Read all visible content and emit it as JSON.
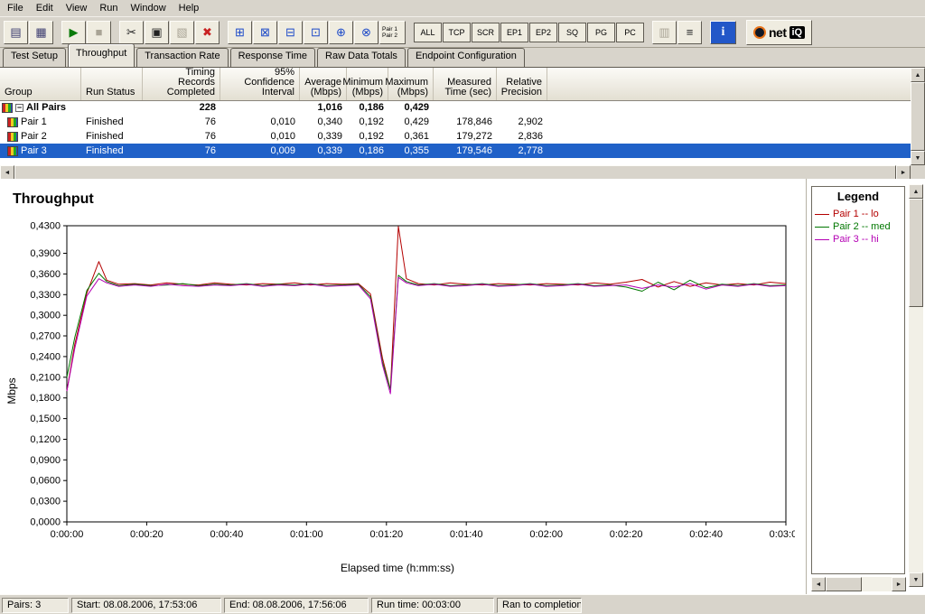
{
  "icons": {
    "arrow_up": "▲",
    "arrow_down": "▼",
    "arrow_left": "◄",
    "arrow_right": "►"
  },
  "colors": {
    "selected_row_bg": "#2061c8",
    "series_pair1": "#b40000",
    "series_pair2": "#007700",
    "series_pair3": "#b400b4"
  },
  "menu": {
    "items": [
      "File",
      "Edit",
      "View",
      "Run",
      "Window",
      "Help"
    ]
  },
  "toolbar": {
    "buttons": [
      {
        "name": "save-button",
        "glyph": "▤",
        "color": "#3a3a6e"
      },
      {
        "name": "print-button",
        "glyph": "▦",
        "color": "#3a3a6e"
      },
      {
        "type": "sep"
      },
      {
        "name": "run-test-button",
        "glyph": "▶",
        "color": "#0a7a0a"
      },
      {
        "name": "abort-run-button",
        "glyph": "■",
        "color": "#a9a496",
        "disabled": true
      },
      {
        "type": "sep"
      },
      {
        "name": "cut-button",
        "glyph": "✂",
        "color": "#222222"
      },
      {
        "name": "copy-button",
        "glyph": "▣",
        "color": "#222222"
      },
      {
        "name": "paste-button",
        "glyph": "▧",
        "color": "#a9a496",
        "disabled": true
      },
      {
        "name": "delete-button",
        "glyph": "✖",
        "color": "#c82222"
      },
      {
        "type": "sep"
      },
      {
        "name": "add-pair-button",
        "glyph": "⊞",
        "color": "#1b49c8"
      },
      {
        "name": "add-multicast-group-button",
        "glyph": "⊠",
        "color": "#1b49c8"
      },
      {
        "name": "edit-pair-button",
        "glyph": "⊟",
        "color": "#1b49c8"
      },
      {
        "name": "replicate-pair-button",
        "glyph": "⊡",
        "color": "#1b49c8"
      },
      {
        "name": "swap-endpoints-button",
        "glyph": "⊕",
        "color": "#1b49c8"
      },
      {
        "name": "group-pairs-button",
        "glyph": "⊗",
        "color": "#1b49c8"
      },
      {
        "name": "pair-list-button",
        "type": "pairtext",
        "lines": [
          "Pair 1",
          "Pair 2"
        ]
      },
      {
        "type": "sep"
      },
      {
        "name": "filter-all-button",
        "type": "text",
        "label": "ALL"
      },
      {
        "name": "filter-tcp-button",
        "type": "text",
        "label": "TCP"
      },
      {
        "name": "filter-scr-button",
        "type": "text",
        "label": "SCR"
      },
      {
        "name": "filter-ep1-button",
        "type": "text",
        "label": "EP1"
      },
      {
        "name": "filter-ep2-button",
        "type": "text",
        "label": "EP2"
      },
      {
        "name": "filter-sq-button",
        "type": "text",
        "label": "SQ"
      },
      {
        "name": "filter-pg-button",
        "type": "text",
        "label": "PG"
      },
      {
        "name": "filter-pc-button",
        "type": "text",
        "label": "PC"
      },
      {
        "type": "sep"
      },
      {
        "name": "column-options-button",
        "glyph": "▥",
        "color": "#a9a496",
        "disabled": true
      },
      {
        "name": "show-grid-button",
        "glyph": "≡",
        "color": "#222222"
      },
      {
        "type": "sep"
      },
      {
        "name": "help-info-button",
        "type": "info",
        "label": "i"
      },
      {
        "type": "sep"
      },
      {
        "name": "netiq-logo",
        "type": "logo",
        "text_net": "net",
        "text_iq": "iQ"
      }
    ]
  },
  "tabs": {
    "active_index": 1,
    "items": [
      "Test Setup",
      "Throughput",
      "Transaction Rate",
      "Response Time",
      "Raw Data Totals",
      "Endpoint Configuration"
    ]
  },
  "table": {
    "columns": [
      {
        "key": "group",
        "label": "Group",
        "width": 90,
        "align": "left"
      },
      {
        "key": "status",
        "label": "Run Status",
        "width": 68,
        "align": "left"
      },
      {
        "key": "records",
        "label": "Timing Records\nCompleted",
        "width": 86,
        "align": "right"
      },
      {
        "key": "confidence",
        "label": "95% Confidence\nInterval",
        "width": 88,
        "align": "right"
      },
      {
        "key": "avg",
        "label": "Average\n(Mbps)",
        "width": 52,
        "align": "right"
      },
      {
        "key": "min",
        "label": "Minimum\n(Mbps)",
        "width": 46,
        "align": "right"
      },
      {
        "key": "max",
        "label": "Maximum\n(Mbps)",
        "width": 50,
        "align": "right"
      },
      {
        "key": "time",
        "label": "Measured\nTime (sec)",
        "width": 70,
        "align": "right"
      },
      {
        "key": "precision",
        "label": "Relative\nPrecision",
        "width": 56,
        "align": "right"
      }
    ],
    "rows": [
      {
        "group": "All Pairs",
        "expand": "−",
        "bold": true,
        "status": "",
        "records": "228",
        "confidence": "",
        "avg": "1,016",
        "min": "0,186",
        "max": "0,429",
        "time": "",
        "precision": ""
      },
      {
        "group": "Pair 1",
        "indent": true,
        "status": "Finished",
        "records": "76",
        "confidence": "0,010",
        "avg": "0,340",
        "min": "0,192",
        "max": "0,429",
        "time": "178,846",
        "precision": "2,902"
      },
      {
        "group": "Pair 2",
        "indent": true,
        "status": "Finished",
        "records": "76",
        "confidence": "0,010",
        "avg": "0,339",
        "min": "0,192",
        "max": "0,361",
        "time": "179,272",
        "precision": "2,836"
      },
      {
        "group": "Pair 3",
        "indent": true,
        "selected": true,
        "status": "Finished",
        "records": "76",
        "confidence": "0,009",
        "avg": "0,339",
        "min": "0,186",
        "max": "0,355",
        "time": "179,546",
        "precision": "2,778"
      }
    ]
  },
  "chart_data": {
    "type": "line",
    "title": "Throughput",
    "xlabel": "Elapsed time (h:mm:ss)",
    "ylabel": "Mbps",
    "xlim": [
      0,
      180
    ],
    "ylim": [
      0,
      0.43
    ],
    "grid": false,
    "legend_position": "right-panel",
    "x_unit": "seconds",
    "xtick_values": [
      0,
      20,
      40,
      60,
      80,
      100,
      120,
      140,
      160,
      180
    ],
    "xtick_labels": [
      "0:00:00",
      "0:00:20",
      "0:00:40",
      "0:01:00",
      "0:01:20",
      "0:01:40",
      "0:02:00",
      "0:02:20",
      "0:02:40",
      "0:03:00"
    ],
    "ytick_values": [
      0,
      0.03,
      0.06,
      0.09,
      0.12,
      0.15,
      0.18,
      0.21,
      0.24,
      0.27,
      0.3,
      0.33,
      0.36,
      0.39,
      0.43
    ],
    "ytick_labels": [
      "0,0000",
      "0,0300",
      "0,0600",
      "0,0900",
      "0,1200",
      "0,1500",
      "0,1800",
      "0,2100",
      "0,2400",
      "0,2700",
      "0,3000",
      "0,3300",
      "0,3600",
      "0,3900",
      "0,4300"
    ],
    "series": [
      {
        "name": "Pair 1 -- lo",
        "color": "#b40000",
        "points": [
          [
            0,
            0.19
          ],
          [
            2,
            0.258
          ],
          [
            5,
            0.332
          ],
          [
            8,
            0.378
          ],
          [
            10,
            0.351
          ],
          [
            13,
            0.345
          ],
          [
            17,
            0.346
          ],
          [
            21,
            0.344
          ],
          [
            25,
            0.347
          ],
          [
            29,
            0.345
          ],
          [
            33,
            0.344
          ],
          [
            37,
            0.347
          ],
          [
            41,
            0.345
          ],
          [
            45,
            0.344
          ],
          [
            49,
            0.346
          ],
          [
            53,
            0.345
          ],
          [
            57,
            0.347
          ],
          [
            61,
            0.344
          ],
          [
            65,
            0.346
          ],
          [
            69,
            0.345
          ],
          [
            73,
            0.346
          ],
          [
            76,
            0.331
          ],
          [
            79,
            0.238
          ],
          [
            81,
            0.192
          ],
          [
            83,
            0.429
          ],
          [
            85,
            0.353
          ],
          [
            88,
            0.346
          ],
          [
            92,
            0.344
          ],
          [
            96,
            0.347
          ],
          [
            100,
            0.345
          ],
          [
            104,
            0.344
          ],
          [
            108,
            0.346
          ],
          [
            112,
            0.345
          ],
          [
            116,
            0.344
          ],
          [
            120,
            0.346
          ],
          [
            124,
            0.345
          ],
          [
            128,
            0.344
          ],
          [
            132,
            0.347
          ],
          [
            136,
            0.345
          ],
          [
            140,
            0.348
          ],
          [
            144,
            0.352
          ],
          [
            148,
            0.341
          ],
          [
            152,
            0.349
          ],
          [
            156,
            0.342
          ],
          [
            160,
            0.347
          ],
          [
            164,
            0.344
          ],
          [
            168,
            0.346
          ],
          [
            172,
            0.344
          ],
          [
            176,
            0.348
          ],
          [
            180,
            0.346
          ]
        ]
      },
      {
        "name": "Pair 2 -- med",
        "color": "#007700",
        "points": [
          [
            0,
            0.21
          ],
          [
            2,
            0.268
          ],
          [
            5,
            0.336
          ],
          [
            8,
            0.361
          ],
          [
            10,
            0.349
          ],
          [
            13,
            0.343
          ],
          [
            17,
            0.345
          ],
          [
            21,
            0.343
          ],
          [
            25,
            0.344
          ],
          [
            29,
            0.346
          ],
          [
            33,
            0.343
          ],
          [
            37,
            0.345
          ],
          [
            41,
            0.344
          ],
          [
            45,
            0.346
          ],
          [
            49,
            0.343
          ],
          [
            53,
            0.345
          ],
          [
            57,
            0.344
          ],
          [
            61,
            0.346
          ],
          [
            65,
            0.343
          ],
          [
            69,
            0.344
          ],
          [
            73,
            0.345
          ],
          [
            76,
            0.327
          ],
          [
            79,
            0.232
          ],
          [
            81,
            0.192
          ],
          [
            83,
            0.358
          ],
          [
            85,
            0.349
          ],
          [
            88,
            0.344
          ],
          [
            92,
            0.346
          ],
          [
            96,
            0.343
          ],
          [
            100,
            0.344
          ],
          [
            104,
            0.346
          ],
          [
            108,
            0.343
          ],
          [
            112,
            0.344
          ],
          [
            116,
            0.346
          ],
          [
            120,
            0.343
          ],
          [
            124,
            0.344
          ],
          [
            128,
            0.346
          ],
          [
            132,
            0.343
          ],
          [
            136,
            0.344
          ],
          [
            140,
            0.341
          ],
          [
            144,
            0.335
          ],
          [
            148,
            0.348
          ],
          [
            152,
            0.337
          ],
          [
            156,
            0.351
          ],
          [
            160,
            0.34
          ],
          [
            164,
            0.345
          ],
          [
            168,
            0.343
          ],
          [
            172,
            0.346
          ],
          [
            176,
            0.343
          ],
          [
            180,
            0.344
          ]
        ]
      },
      {
        "name": "Pair 3 -- hi",
        "color": "#b400b4",
        "points": [
          [
            0,
            0.19
          ],
          [
            2,
            0.252
          ],
          [
            5,
            0.328
          ],
          [
            8,
            0.353
          ],
          [
            10,
            0.347
          ],
          [
            13,
            0.342
          ],
          [
            17,
            0.344
          ],
          [
            21,
            0.342
          ],
          [
            25,
            0.345
          ],
          [
            29,
            0.343
          ],
          [
            33,
            0.342
          ],
          [
            37,
            0.344
          ],
          [
            41,
            0.343
          ],
          [
            45,
            0.345
          ],
          [
            49,
            0.342
          ],
          [
            53,
            0.344
          ],
          [
            57,
            0.343
          ],
          [
            61,
            0.345
          ],
          [
            65,
            0.342
          ],
          [
            69,
            0.343
          ],
          [
            73,
            0.344
          ],
          [
            76,
            0.324
          ],
          [
            79,
            0.228
          ],
          [
            81,
            0.186
          ],
          [
            83,
            0.355
          ],
          [
            85,
            0.347
          ],
          [
            88,
            0.343
          ],
          [
            92,
            0.345
          ],
          [
            96,
            0.342
          ],
          [
            100,
            0.343
          ],
          [
            104,
            0.345
          ],
          [
            108,
            0.342
          ],
          [
            112,
            0.343
          ],
          [
            116,
            0.345
          ],
          [
            120,
            0.342
          ],
          [
            124,
            0.343
          ],
          [
            128,
            0.345
          ],
          [
            132,
            0.342
          ],
          [
            136,
            0.343
          ],
          [
            140,
            0.344
          ],
          [
            144,
            0.339
          ],
          [
            148,
            0.344
          ],
          [
            152,
            0.341
          ],
          [
            156,
            0.346
          ],
          [
            160,
            0.338
          ],
          [
            164,
            0.344
          ],
          [
            168,
            0.342
          ],
          [
            172,
            0.345
          ],
          [
            176,
            0.342
          ],
          [
            180,
            0.343
          ]
        ]
      }
    ]
  },
  "legend": {
    "title": "Legend",
    "entries": [
      {
        "label": "Pair 1 -- lo",
        "color": "#b40000"
      },
      {
        "label": "Pair 2 -- med",
        "color": "#007700"
      },
      {
        "label": "Pair 3 -- hi",
        "color": "#b400b4"
      }
    ]
  },
  "statusbar": {
    "cells": [
      {
        "name": "pairs-count",
        "text": "Pairs: 3",
        "width": 74
      },
      {
        "name": "start-time",
        "text": "Start: 08.08.2006, 17:53:06",
        "width": 166
      },
      {
        "name": "end-time",
        "text": "End: 08.08.2006, 17:56:06",
        "width": 160
      },
      {
        "name": "run-time",
        "text": "Run time: 00:03:00",
        "width": 136
      },
      {
        "name": "run-result",
        "text": "Ran to completion",
        "width": 94
      }
    ]
  }
}
